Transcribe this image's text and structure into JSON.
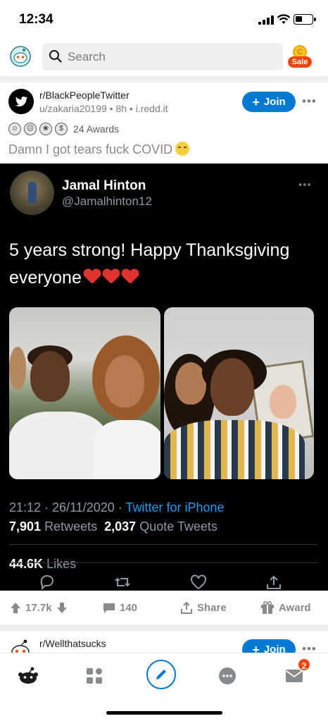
{
  "status_bar": {
    "time": "12:34"
  },
  "header": {
    "search_placeholder": "Search",
    "coin_label": "C",
    "sale_label": "Sale"
  },
  "post": {
    "subreddit": "r/BlackPeopleTwitter",
    "author": "u/zakaria20199",
    "age": "8h",
    "domain": "i.redd.it",
    "join_label": "Join",
    "awards_count": "24 Awards",
    "title": "Damn I got tears fuck COVID",
    "upvotes": "17.7k",
    "comments": "140",
    "share_label": "Share",
    "award_label": "Award"
  },
  "tweet": {
    "name": "Jamal Hinton",
    "handle": "@Jamalhinton12",
    "text": "5 years strong! Happy Thanksgiving everyone",
    "time": "21:12 · 26/11/2020 · ",
    "source": "Twitter for iPhone",
    "retweets": "7,901",
    "retweets_label": "Retweets",
    "quote_tweets": "2,037",
    "quote_tweets_label": "Quote Tweets",
    "likes": "44.6K",
    "likes_label": "Likes"
  },
  "next_post": {
    "subreddit": "r/Wellthatsucks",
    "join_label": "Join"
  },
  "tab_bar": {
    "inbox_badge": "2"
  },
  "colors": {
    "accent": "#0079d3",
    "orangered": "#ff4500",
    "twitter_blue": "#1d9bf0"
  }
}
